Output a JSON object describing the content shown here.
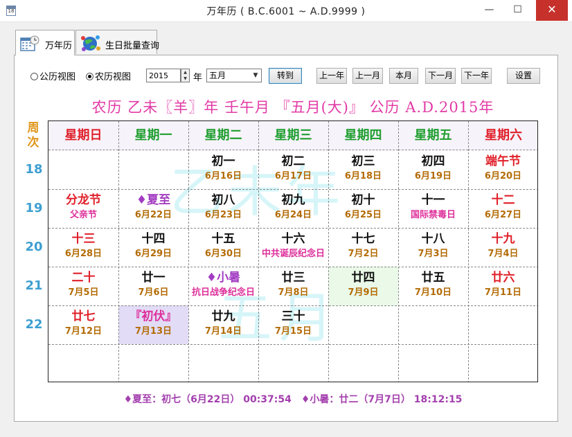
{
  "window": {
    "title": "万年历 ( B.C.6001 ~ A.D.9999 )",
    "icon_text": "18",
    "minimize_glyph": "—",
    "maximize_glyph": "☐",
    "close_glyph": "✕"
  },
  "tabs": [
    {
      "label": "万年历",
      "active": true,
      "icon": "calendar-clock-icon"
    },
    {
      "label": "生日批量查询",
      "active": false,
      "icon": "network-globe-icon"
    }
  ],
  "toolbar": {
    "radio_solar": "公历视图",
    "radio_lunar": "农历视图",
    "radio_selected": "农历视图",
    "year_value": "2015",
    "year_unit": "年",
    "month_value": "五月",
    "goto": "转到",
    "prev_year": "上一年",
    "prev_month": "上一月",
    "this_month": "本月",
    "next_month": "下一月",
    "next_year": "下一年",
    "settings": "设置"
  },
  "banner": "农历 乙未〖羊〗年 壬午月 『五月(大)』 公历 A.D.2015年",
  "week_column_header": "周次",
  "watermark": {
    "line1": "乙未年",
    "line2": "五月"
  },
  "weekdays": [
    {
      "label": "星期日",
      "color": "#e0202a"
    },
    {
      "label": "星期一",
      "color": "#1e9e2e"
    },
    {
      "label": "星期二",
      "color": "#1e9e2e"
    },
    {
      "label": "星期三",
      "color": "#1e9e2e"
    },
    {
      "label": "星期四",
      "color": "#1e9e2e"
    },
    {
      "label": "星期五",
      "color": "#1e9e2e"
    },
    {
      "label": "星期六",
      "color": "#e0202a"
    }
  ],
  "week_numbers": [
    "18",
    "19",
    "20",
    "21",
    "22"
  ],
  "weeks": [
    [
      null,
      null,
      {
        "top": "初一",
        "bot": "6月16日",
        "tc": "black",
        "bc": "brown"
      },
      {
        "top": "初二",
        "bot": "6月17日",
        "tc": "black",
        "bc": "brown"
      },
      {
        "top": "初三",
        "bot": "6月18日",
        "tc": "black",
        "bc": "brown"
      },
      {
        "top": "初四",
        "bot": "6月19日",
        "tc": "black",
        "bc": "brown"
      },
      {
        "top": "端午节",
        "bot": "6月20日",
        "tc": "red",
        "bc": "brown"
      }
    ],
    [
      {
        "top": "分龙节",
        "bot": "父亲节",
        "tc": "red",
        "bc": "magenta"
      },
      {
        "top": "♦夏至",
        "bot": "6月22日",
        "tc": "purple",
        "bc": "brown"
      },
      {
        "top": "初八",
        "bot": "6月23日",
        "tc": "black",
        "bc": "brown"
      },
      {
        "top": "初九",
        "bot": "6月24日",
        "tc": "black",
        "bc": "brown"
      },
      {
        "top": "初十",
        "bot": "6月25日",
        "tc": "black",
        "bc": "brown"
      },
      {
        "top": "十一",
        "bot": "国际禁毒日",
        "tc": "black",
        "bc": "magenta"
      },
      {
        "top": "十二",
        "bot": "6月27日",
        "tc": "red",
        "bc": "brown"
      }
    ],
    [
      {
        "top": "十三",
        "bot": "6月28日",
        "tc": "red",
        "bc": "brown"
      },
      {
        "top": "十四",
        "bot": "6月29日",
        "tc": "black",
        "bc": "brown"
      },
      {
        "top": "十五",
        "bot": "6月30日",
        "tc": "black",
        "bc": "brown"
      },
      {
        "top": "十六",
        "bot": "中共诞辰纪念日",
        "tc": "black",
        "bc": "magenta"
      },
      {
        "top": "十七",
        "bot": "7月2日",
        "tc": "black",
        "bc": "brown"
      },
      {
        "top": "十八",
        "bot": "7月3日",
        "tc": "black",
        "bc": "brown"
      },
      {
        "top": "十九",
        "bot": "7月4日",
        "tc": "red",
        "bc": "brown"
      }
    ],
    [
      {
        "top": "二十",
        "bot": "7月5日",
        "tc": "red",
        "bc": "brown"
      },
      {
        "top": "廿一",
        "bot": "7月6日",
        "tc": "black",
        "bc": "brown"
      },
      {
        "top": "♦小暑",
        "bot": "抗日战争纪念日",
        "tc": "purple",
        "bc": "magenta"
      },
      {
        "top": "廿三",
        "bot": "7月8日",
        "tc": "black",
        "bc": "brown"
      },
      {
        "top": "廿四",
        "bot": "7月9日",
        "tc": "black",
        "bc": "brown",
        "bg": "green"
      },
      {
        "top": "廿五",
        "bot": "7月10日",
        "tc": "black",
        "bc": "brown"
      },
      {
        "top": "廿六",
        "bot": "7月11日",
        "tc": "red",
        "bc": "brown"
      }
    ],
    [
      {
        "top": "廿七",
        "bot": "7月12日",
        "tc": "red",
        "bc": "brown"
      },
      {
        "top": "『初伏』",
        "bot": "7月13日",
        "tc": "magenta",
        "bc": "brown",
        "bg": "lilac"
      },
      {
        "top": "廿九",
        "bot": "7月14日",
        "tc": "black",
        "bc": "brown"
      },
      {
        "top": "三十",
        "bot": "7月15日",
        "tc": "black",
        "bc": "brown"
      },
      null,
      null,
      null
    ]
  ],
  "solar_terms": "♦夏至：初七（6月22日） 00:37:54　♦小暑：廿二（7月7日） 18:12:15"
}
